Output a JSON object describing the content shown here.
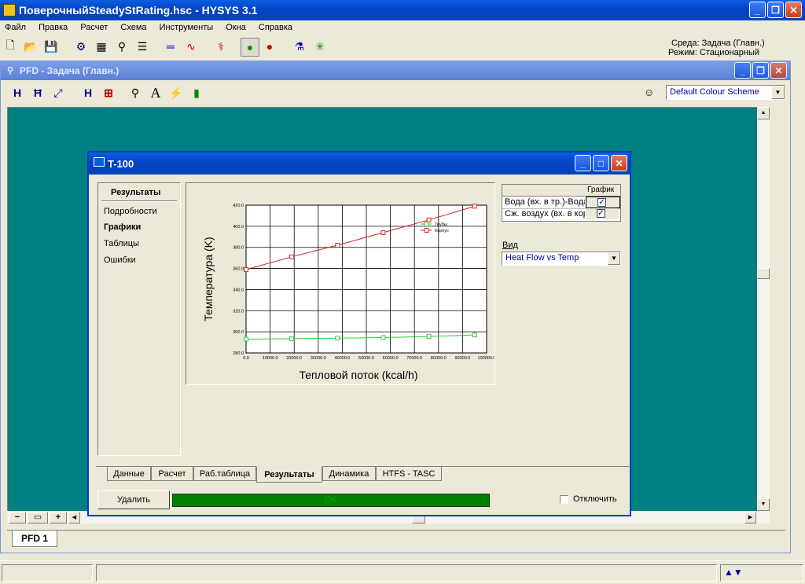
{
  "app": {
    "title": "ПоверочныйSteadyStRating.hsc - HYSYS 3.1",
    "menu": [
      "Файл",
      "Правка",
      "Расчет",
      "Схема",
      "Инструменты",
      "Окна",
      "Справка"
    ],
    "env_line1": "Среда: Задача (Главн.)",
    "env_line2": "Режим: Стационарный"
  },
  "pfd": {
    "title": "PFD - Задача (Главн.)",
    "colour_scheme": "Default Colour Scheme",
    "tab": "PFD 1"
  },
  "dialog": {
    "title": "T-100",
    "nav_header": "Результаты",
    "nav_items": [
      "Подробности",
      "Графики",
      "Таблицы",
      "Ошибки"
    ],
    "table": {
      "header": "График",
      "rows": [
        {
          "label": "Вода (вх. в тр.)-Вода",
          "checked": true
        },
        {
          "label": "Сж. воздух (вх. в кор",
          "checked": true
        }
      ]
    },
    "view_label": "Вид",
    "view_value": "Heat Flow vs Temp",
    "tabs": [
      "Данные",
      "Расчет",
      "Раб.таблица",
      "Результаты",
      "Динамика",
      "HTFS - TASC"
    ],
    "delete_button": "Удалить",
    "status": "OK",
    "disable_label": "Отключить"
  },
  "chart_data": {
    "type": "line",
    "xlabel": "Тепловой поток (kcal/h)",
    "ylabel": "Температура (K)",
    "xlim": [
      0,
      100000
    ],
    "ylim": [
      280,
      420
    ],
    "xticks": [
      "0.0",
      "10000.0",
      "20000.0",
      "30000.0",
      "40000.0",
      "50000.0",
      "60000.0",
      "70000.0",
      "80000.0",
      "90000.0",
      "100000.0"
    ],
    "yticks": [
      "280.0",
      "300.0",
      "320.0",
      "340.0",
      "360.0",
      "380.0",
      "400.0",
      "420.0"
    ],
    "grid": true,
    "legend": "top-right",
    "series": [
      {
        "name": "Трубы",
        "color": "#33cc33",
        "x": [
          0,
          19000,
          38000,
          57000,
          76000,
          95000
        ],
        "y": [
          293,
          293.5,
          294,
          294.5,
          295.5,
          297
        ]
      },
      {
        "name": "Корпус",
        "color": "#dd2222",
        "x": [
          0,
          19000,
          38000,
          57000,
          76000,
          95000
        ],
        "y": [
          359,
          371,
          382,
          394,
          406,
          419
        ]
      }
    ]
  }
}
